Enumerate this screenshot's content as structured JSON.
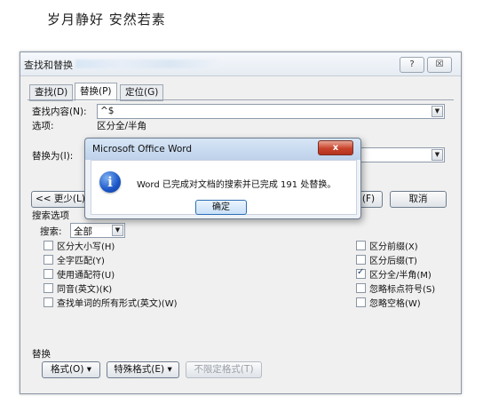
{
  "page": {
    "heading": "岁月静好 安然若素"
  },
  "dialog": {
    "title": "查找和替换",
    "help_label": "?",
    "close_label": "☒",
    "tabs": [
      {
        "label": "查找(D)",
        "active": false
      },
      {
        "label": "替换(P)",
        "active": true
      },
      {
        "label": "定位(G)",
        "active": false
      }
    ],
    "find": {
      "label": "查找内容(N):",
      "value": "^$"
    },
    "options": {
      "label": "选项:",
      "value": "区分全/半角"
    },
    "replace": {
      "label": "替换为(I):",
      "value": ""
    },
    "less_button": "<< 更少(L)",
    "right_button_fragment": "(F)",
    "cancel_button": "取消",
    "search_options_title": "搜索选项",
    "search": {
      "label": "搜索:",
      "value": "全部"
    },
    "left_options": [
      {
        "label": "区分大小写(H)",
        "checked": false
      },
      {
        "label": "全字匹配(Y)",
        "checked": false
      },
      {
        "label": "使用通配符(U)",
        "checked": false
      },
      {
        "label": "同音(英文)(K)",
        "checked": false
      },
      {
        "label": "查找单词的所有形式(英文)(W)",
        "checked": false
      }
    ],
    "right_options": [
      {
        "label": "区分前缀(X)",
        "checked": false
      },
      {
        "label": "区分后缀(T)",
        "checked": false
      },
      {
        "label": "区分全/半角(M)",
        "checked": true
      },
      {
        "label": "忽略标点符号(S)",
        "checked": false
      },
      {
        "label": "忽略空格(W)",
        "checked": false
      }
    ],
    "replace_section_title": "替换",
    "format_button": "格式(O) ▾",
    "special_button": "特殊格式(E) ▾",
    "no_format_button": "不限定格式(T)"
  },
  "message_box": {
    "title": "Microsoft Office Word",
    "close_label": "x",
    "text": "Word 已完成对文档的搜索并已完成 191 处替换。",
    "ok_label": "确定",
    "icon": "info-icon"
  }
}
